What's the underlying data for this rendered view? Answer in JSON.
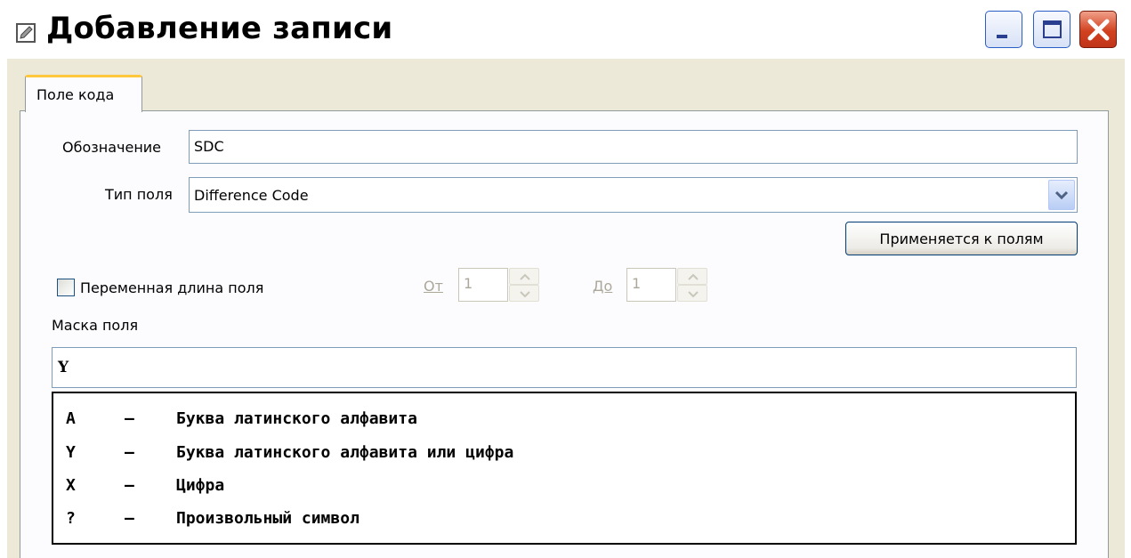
{
  "window": {
    "title": "Добавление записи",
    "icon": "edit-icon",
    "controls": [
      "minimize-icon",
      "maximize-icon",
      "close-icon"
    ]
  },
  "tabs": [
    {
      "label": "Поле кода",
      "active": true
    }
  ],
  "form": {
    "designation_label": "Обозначение",
    "designation_value": "SDC",
    "field_type_label": "Тип поля",
    "field_type_value": "Difference Code",
    "applies_button": "Применяется к полям",
    "variable_length_label": "Переменная длина поля",
    "variable_length_checked": false,
    "from_label": "От",
    "from_value": "1",
    "to_label": "До",
    "to_value": "1",
    "mask_label": "Маска поля",
    "mask_value": "Y"
  },
  "legend": [
    {
      "key": "A",
      "dash": "–",
      "text": "Буква латинского алфавита"
    },
    {
      "key": "Y",
      "dash": "–",
      "text": "Буква латинского алфавита или цифра"
    },
    {
      "key": "X",
      "dash": "–",
      "text": "Цифра"
    },
    {
      "key": "?",
      "dash": "–",
      "text": "Произвольный символ"
    }
  ],
  "colors": {
    "tab_accent": "#ffc83c",
    "close_button": "#d1421f",
    "border_blue": "#7f9db9",
    "disabled_text": "#aca899"
  }
}
